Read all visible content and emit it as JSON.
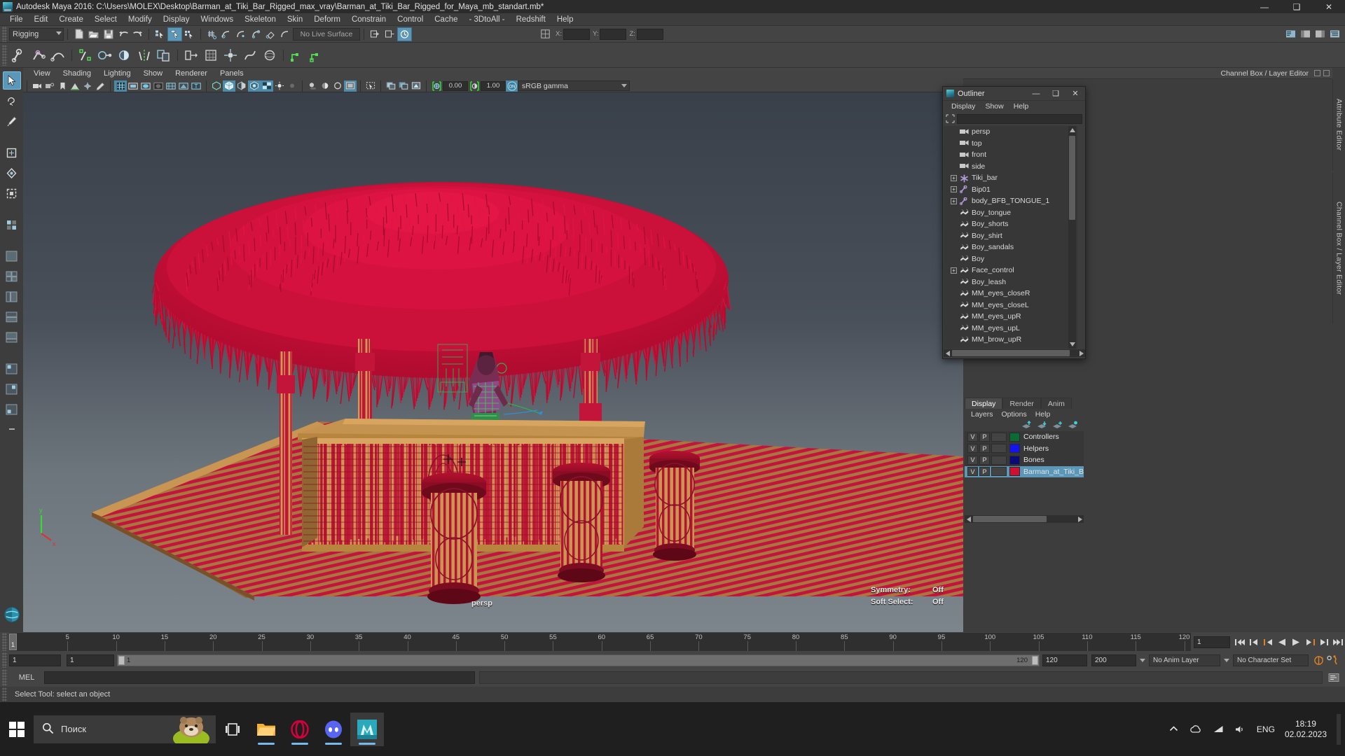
{
  "titlebar": {
    "app_icon": "maya-icon",
    "title": "Autodesk Maya 2016: C:\\Users\\MOLEX\\Desktop\\Barman_at_Tiki_Bar_Rigged_max_vray\\Barman_at_Tiki_Bar_Rigged_for_Maya_mb_standart.mb*",
    "minimize": "—",
    "maximize": "❑",
    "close": "✕"
  },
  "menubar": {
    "items": [
      "File",
      "Edit",
      "Create",
      "Select",
      "Modify",
      "Display",
      "Windows",
      "Skeleton",
      "Skin",
      "Deform",
      "Constrain",
      "Control",
      "Cache",
      "- 3DtoAll -",
      "Redshift",
      "Help"
    ]
  },
  "statusline": {
    "menuset": "Rigging",
    "live_surface": "No Live Surface",
    "coord_x_label": "X:",
    "coord_y_label": "Y:",
    "coord_z_label": "Z:",
    "coord_x_value": "",
    "coord_y_value": "",
    "coord_z_value": ""
  },
  "viewport_menu": {
    "items": [
      "View",
      "Shading",
      "Lighting",
      "Show",
      "Renderer",
      "Panels"
    ]
  },
  "viewport_tools": {
    "exposure": "0.00",
    "gamma": "1.00",
    "color_mode": "sRGB gamma",
    "gamma_toggle": "ON"
  },
  "viewport_hud": {
    "camera": "persp",
    "symmetry_label": "Symmetry:",
    "symmetry_value": "Off",
    "soft_select_label": "Soft Select:",
    "soft_select_value": "Off"
  },
  "channelbox_strip": {
    "title": "Channel Box / Layer Editor",
    "vertical_tab_attr": "Attribute Editor",
    "vertical_tab_cb": "Channel Box / Layer Editor"
  },
  "outliner": {
    "icon": "maya-icon",
    "title": "Outliner",
    "minimize": "—",
    "maximize": "❑",
    "close": "✕",
    "menus": [
      "Display",
      "Show",
      "Help"
    ],
    "search_value": "",
    "search_placeholder": "",
    "items": [
      {
        "label": "persp",
        "icon": "camera-icon",
        "expandable": false
      },
      {
        "label": "top",
        "icon": "camera-icon",
        "expandable": false
      },
      {
        "label": "front",
        "icon": "camera-icon",
        "expandable": false
      },
      {
        "label": "side",
        "icon": "camera-icon",
        "expandable": false
      },
      {
        "label": "Tiki_bar",
        "icon": "group-icon",
        "expandable": true
      },
      {
        "label": "Bip01",
        "icon": "joint-icon",
        "expandable": true
      },
      {
        "label": "body_BFB_TONGUE_1",
        "icon": "joint-icon",
        "expandable": true
      },
      {
        "label": "Boy_tongue",
        "icon": "mesh-icon",
        "expandable": false
      },
      {
        "label": "Boy_shorts",
        "icon": "mesh-icon",
        "expandable": false
      },
      {
        "label": "Boy_shirt",
        "icon": "mesh-icon",
        "expandable": false
      },
      {
        "label": "Boy_sandals",
        "icon": "mesh-icon",
        "expandable": false
      },
      {
        "label": "Boy",
        "icon": "mesh-icon",
        "expandable": false
      },
      {
        "label": "Face_control",
        "icon": "mesh-icon",
        "expandable": true
      },
      {
        "label": "Boy_leash",
        "icon": "mesh-icon",
        "expandable": false
      },
      {
        "label": "MM_eyes_closeR",
        "icon": "mesh-icon",
        "expandable": false
      },
      {
        "label": "MM_eyes_closeL",
        "icon": "mesh-icon",
        "expandable": false
      },
      {
        "label": "MM_eyes_upR",
        "icon": "mesh-icon",
        "expandable": false
      },
      {
        "label": "MM_eyes_upL",
        "icon": "mesh-icon",
        "expandable": false
      },
      {
        "label": "MM_brow_upR",
        "icon": "mesh-icon",
        "expandable": false
      }
    ]
  },
  "layer_editor": {
    "tabs": [
      "Display",
      "Render",
      "Anim"
    ],
    "active_tab": "Display",
    "menus": [
      "Layers",
      "Options",
      "Help"
    ],
    "col_v": "V",
    "col_p": "P",
    "layers": [
      {
        "name": "Controllers",
        "color": "#0a6b34",
        "visible": "V",
        "playback": "P",
        "selected": false
      },
      {
        "name": "Helpers",
        "color": "#1414f0",
        "visible": "V",
        "playback": "P",
        "selected": false
      },
      {
        "name": "Bones",
        "color": "#0a0a78",
        "visible": "V",
        "playback": "P",
        "selected": false
      },
      {
        "name": "Barman_at_Tiki_Bar_Ri",
        "color": "#d01030",
        "visible": "V",
        "playback": "P",
        "selected": true
      }
    ]
  },
  "time_slider": {
    "current_frame": "1",
    "tick_labels": [
      "5",
      "10",
      "15",
      "20",
      "25",
      "30",
      "35",
      "40",
      "45",
      "50",
      "55",
      "60",
      "65",
      "70",
      "75",
      "80",
      "85",
      "90",
      "95",
      "100",
      "105",
      "110",
      "115",
      "120"
    ],
    "frame_field": "1"
  },
  "range_slider": {
    "start_field": "1",
    "playback_start_field": "1",
    "bar_start_label": "1",
    "bar_end_label": "120",
    "playback_end_field": "120",
    "end_field": "200",
    "anim_layer": "No Anim Layer",
    "character_set": "No Character Set"
  },
  "command_line": {
    "label": "MEL",
    "input_value": "",
    "output_value": ""
  },
  "help_line": {
    "text": "Select Tool: select an object"
  },
  "taskbar": {
    "search_placeholder": "Поиск",
    "start_icon": "windows-start-icon",
    "search_icon": "search-icon",
    "items": [
      {
        "name": "task-view-icon",
        "running": false
      },
      {
        "name": "file-explorer-icon",
        "running": true
      },
      {
        "name": "opera-browser-icon",
        "running": true
      },
      {
        "name": "discord-icon",
        "running": true
      },
      {
        "name": "maya-taskbar-icon",
        "running": true,
        "active": true
      }
    ],
    "tray": {
      "chevron": "show-hidden-icons",
      "language": "ENG",
      "time": "18:19",
      "date": "02.02.2023"
    }
  },
  "colors": {
    "accent_blue": "#5b97b8",
    "panel_bg": "#3d3d3d",
    "dark_bg": "#2e2e2e",
    "highlight_green": "#30e030",
    "layer_red": "#d01030"
  }
}
